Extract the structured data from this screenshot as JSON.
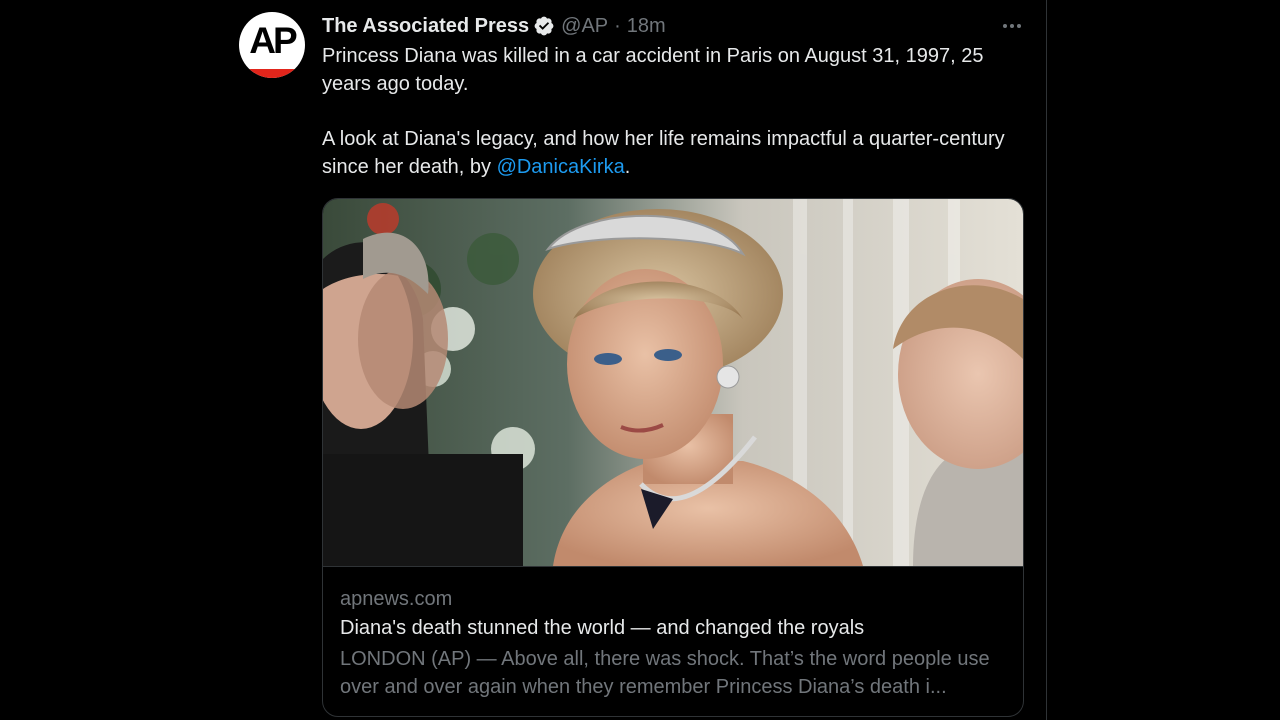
{
  "account": {
    "display_name": "The Associated Press",
    "handle": "@AP",
    "separator": "·",
    "time": "18m",
    "avatar_text": "AP",
    "verified": true
  },
  "tweet": {
    "text_line_1": "Princess Diana was killed in a car accident in Paris on August 31, 1997, 25 years ago today.",
    "text_line_2_prefix": "A look at Diana's legacy, and how her life remains impactful a quarter-century since her death, by ",
    "mention": "@DanicaKirka",
    "text_line_2_suffix": "."
  },
  "card": {
    "domain": "apnews.com",
    "title": "Diana's death stunned the world — and changed the royals",
    "description": "LONDON (AP) — Above all, there was shock. That’s the word people use over and over again when they remember Princess Diana’s death i..."
  },
  "icons": {
    "verified": "verified-badge-icon",
    "more": "more-options-icon"
  },
  "colors": {
    "background": "#000000",
    "text": "#e7e9ea",
    "secondary": "#71767b",
    "link": "#1d9bf0",
    "border": "#2f3336",
    "ap_red": "#e1251b"
  }
}
